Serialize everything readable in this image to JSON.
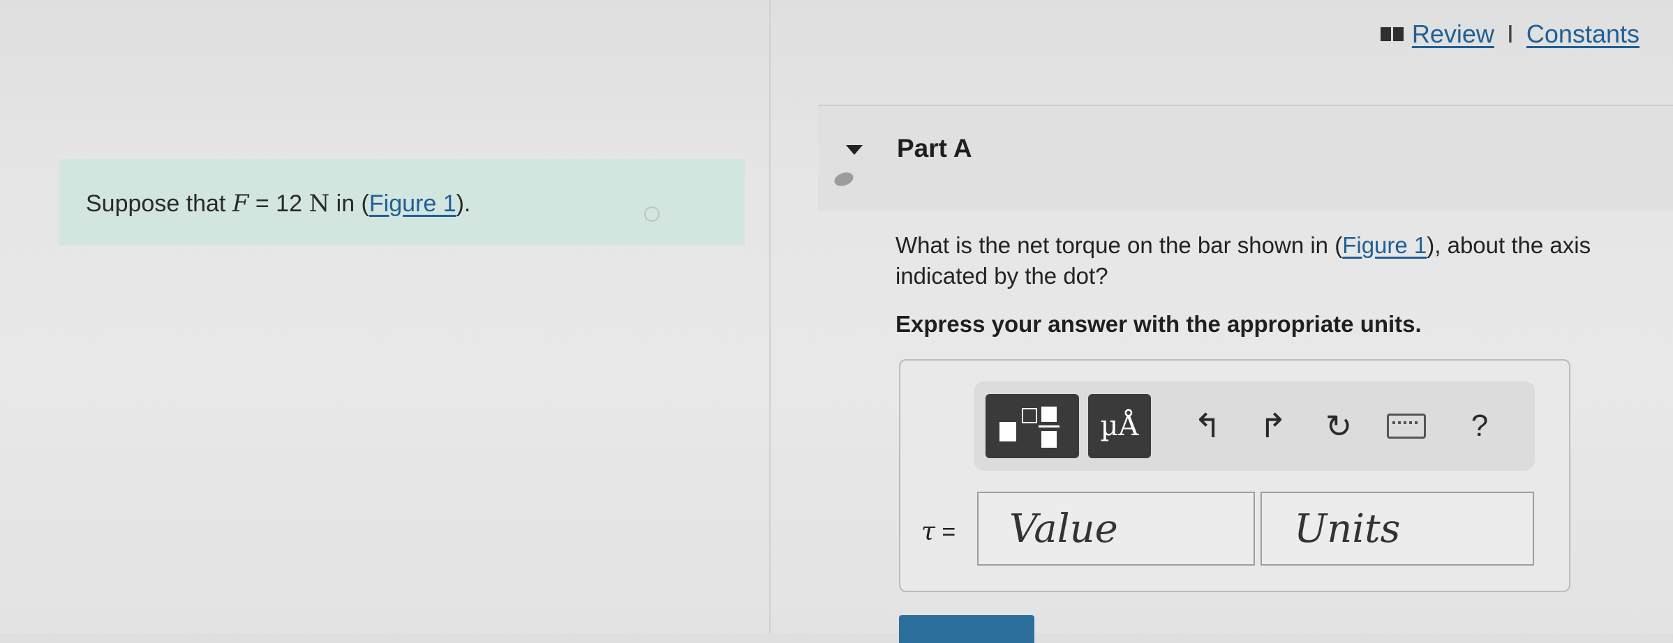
{
  "header": {
    "review_label": "Review",
    "separator": "I",
    "constants_label": "Constants"
  },
  "problem": {
    "prefix": "Suppose that ",
    "variable": "F",
    "equals": " = 12 ",
    "unit": "N",
    "in_text": " in (",
    "figure_link": "Figure 1",
    "suffix": ")."
  },
  "part": {
    "title": "Part A",
    "question_before": "What is the net torque on the bar shown in (",
    "figure_link": "Figure 1",
    "question_after": "), about the axis indicated by the dot?",
    "instruction": "Express your answer with the appropriate units."
  },
  "answer": {
    "units_button": "µÅ",
    "help_button": "?",
    "variable": "τ",
    "equals": " =",
    "value_placeholder": "Value",
    "units_placeholder": "Units"
  },
  "icons": [
    "book-icon",
    "templates-icon",
    "undo-icon",
    "redo-icon",
    "reset-icon",
    "keyboard-icon",
    "help-icon"
  ],
  "colors": {
    "link": "#1f5f96",
    "panel": "#d3e5df",
    "submit": "#2c6f9c",
    "toolbar_button": "#3a3a3a"
  }
}
